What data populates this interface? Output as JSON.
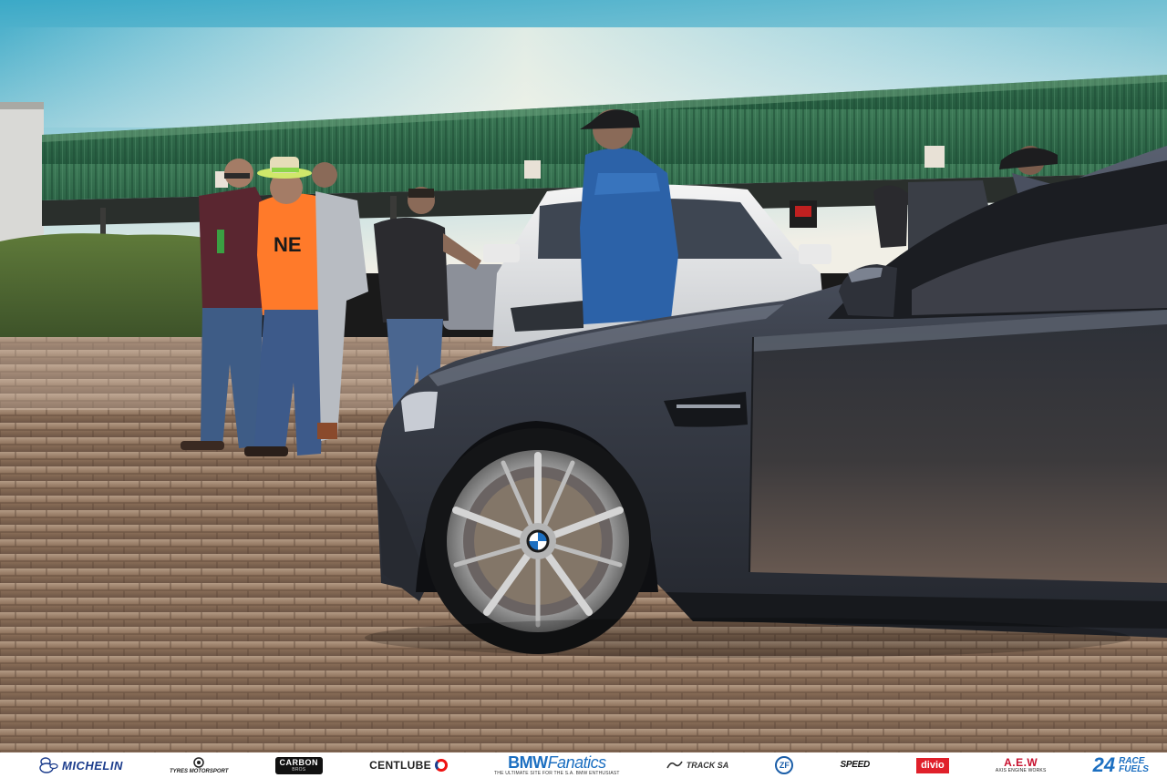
{
  "sponsors": {
    "michelin": "MICHELIN",
    "tyres_motorsport": "TYRES MOTORSPORT",
    "carbon_bros": "CARBON",
    "carbon_bros_sub": "BROS",
    "centlube": "CENTLUBE",
    "bmw_fanatics_a": "BMW",
    "bmw_fanatics_b": "Fanatics",
    "bmw_fanatics_tagline": "THE ULTIMATE SITE FOR THE S.A. BMW ENTHUSIAST",
    "track_sa": "TRACK SA",
    "zf": "ZF",
    "speed_sound": "SPEED",
    "divio": "divio",
    "aew": "A.E.W",
    "aew_sub": "AXIS ENGINE WORKS",
    "race_fuels_num": "24",
    "race_fuels_a": "RACE",
    "race_fuels_b": "FUELS"
  },
  "colors": {
    "sky_top": "#3ba9c7",
    "roof_green": "#2e6b4a",
    "car_body": "#3a3f4a",
    "pavement": "#8a6e58",
    "shirt_orange": "#ff7a2a",
    "jacket_blue": "#2c62a8"
  }
}
